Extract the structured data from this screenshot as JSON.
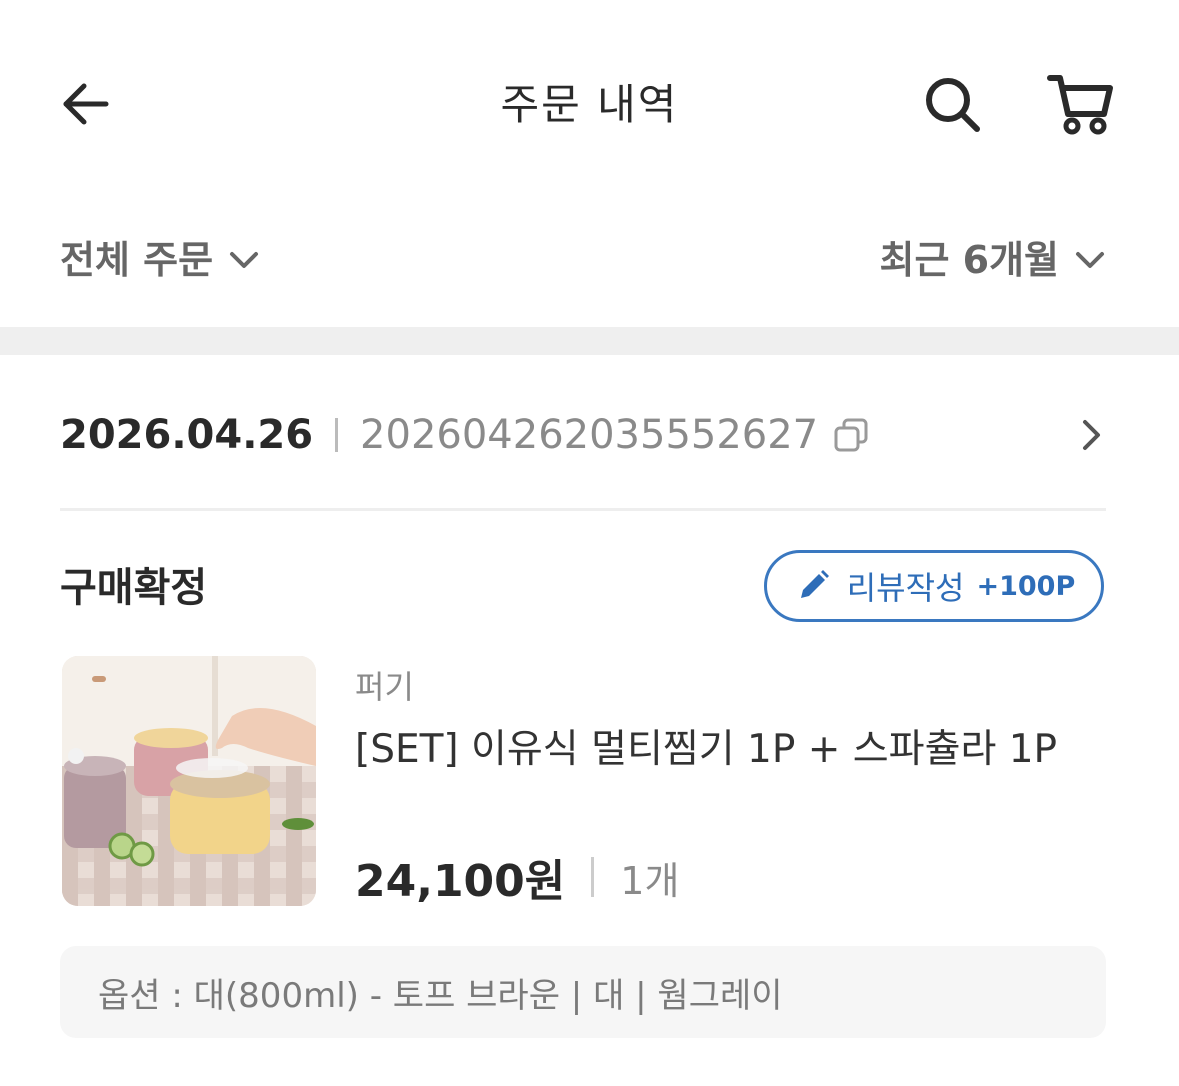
{
  "header": {
    "title": "주문 내역",
    "back_icon": "arrow-left-icon",
    "search_icon": "search-icon",
    "cart_icon": "cart-icon"
  },
  "filters": {
    "order_type": "전체 주문",
    "period": "최근 6개월"
  },
  "order": {
    "date": "2026.04.26",
    "order_number": "20260426203555​2627",
    "status": "구매확정",
    "review_button": {
      "label": "리뷰작성",
      "points": "+100P"
    },
    "item": {
      "brand": "퍼기",
      "name": "[SET] 이유식 멀티찜기 1P + 스파츌라 1P",
      "price": "24,100원",
      "quantity": "1개",
      "option": "옵션 : 대(800ml) - 토프 브라운 | 대 | 웜그레이"
    }
  },
  "colors": {
    "accent": "#2e6db8",
    "band": "#efefef",
    "option_bg": "#f6f6f6"
  }
}
